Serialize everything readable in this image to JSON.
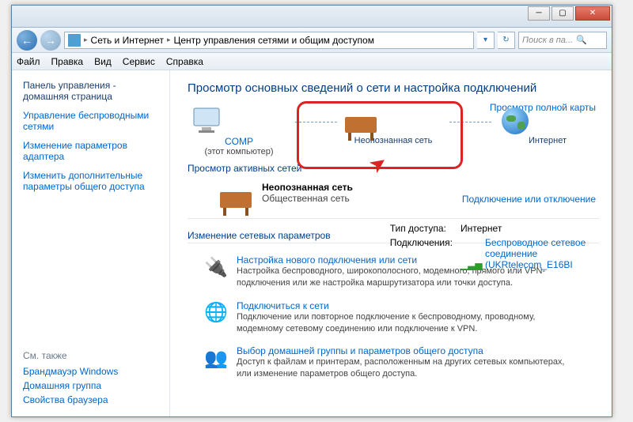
{
  "window": {
    "breadcrumb": {
      "item1": "Сеть и Интернет",
      "item2": "Центр управления сетями и общим доступом"
    },
    "search_placeholder": "Поиск в па..."
  },
  "menu": {
    "file": "Файл",
    "edit": "Правка",
    "view": "Вид",
    "service": "Сервис",
    "help": "Справка"
  },
  "sidebar": {
    "home": "Панель управления - домашняя страница",
    "wireless": "Управление беспроводными сетями",
    "adapter": "Изменение параметров адаптера",
    "sharing": "Изменить дополнительные параметры общего доступа"
  },
  "seealso": {
    "header": "См. также",
    "firewall": "Брандмауэр Windows",
    "homegroup": "Домашняя группа",
    "browser": "Свойства браузера"
  },
  "main": {
    "title": "Просмотр основных сведений о сети и настройка подключений",
    "map_link": "Просмотр полной карты",
    "net_comp": "COMP",
    "net_comp_sub": "(этот компьютер)",
    "net_unknown": "Неопознанная сеть",
    "net_internet": "Интернет",
    "active_header": "Просмотр активных сетей",
    "conn_link": "Подключение или отключение",
    "active_name": "Неопознанная сеть",
    "active_type": "Общественная сеть",
    "props": {
      "access_label": "Тип доступа:",
      "access_value": "Интернет",
      "conn_label": "Подключения:",
      "conn_value": "Беспроводное сетевое соединение (UKRtelecom_E16BI"
    },
    "change_header": "Изменение сетевых параметров",
    "tasks": [
      {
        "title": "Настройка нового подключения или сети",
        "desc": "Настройка беспроводного, широкополосного, модемного, прямого или VPN-подключения или же настройка маршрутизатора или точки доступа."
      },
      {
        "title": "Подключиться к сети",
        "desc": "Подключение или повторное подключение к беспроводному, проводному, модемному сетевому соединению или подключение к VPN."
      },
      {
        "title": "Выбор домашней группы и параметров общего доступа",
        "desc": "Доступ к файлам и принтерам, расположенным на других сетевых компьютерах, или изменение параметров общего доступа."
      }
    ]
  }
}
